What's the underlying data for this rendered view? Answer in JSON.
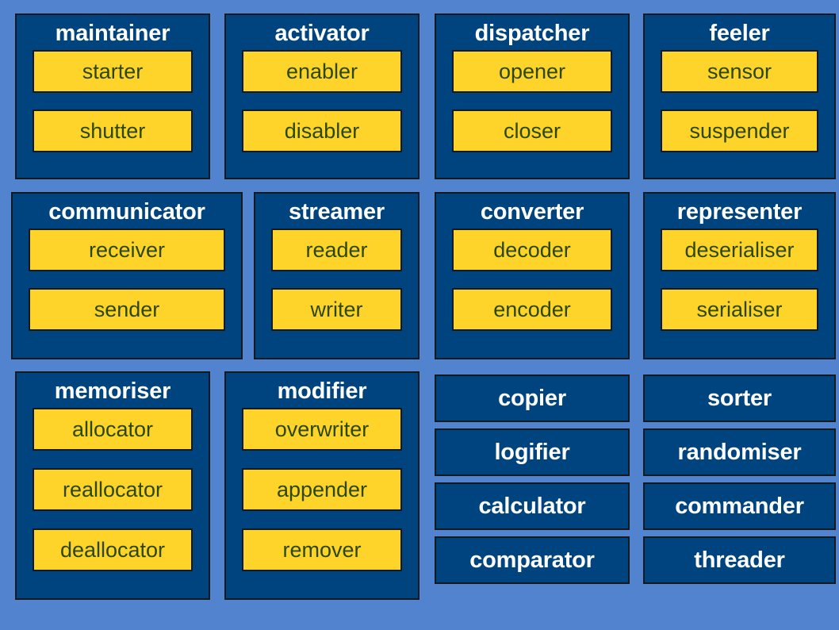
{
  "palette": {
    "background": "#5183ce",
    "card_blue": "#00447f",
    "chip_yellow": "#ffd42a",
    "outline": "#141a20",
    "title_text": "#ffffff",
    "chip_text": "#2c4800"
  },
  "groups": [
    {
      "title": "maintainer",
      "children": [
        "starter",
        "shutter"
      ]
    },
    {
      "title": "activator",
      "children": [
        "enabler",
        "disabler"
      ]
    },
    {
      "title": "dispatcher",
      "children": [
        "opener",
        "closer"
      ]
    },
    {
      "title": "feeler",
      "children": [
        "sensor",
        "suspender"
      ]
    },
    {
      "title": "communicator",
      "children": [
        "receiver",
        "sender"
      ]
    },
    {
      "title": "streamer",
      "children": [
        "reader",
        "writer"
      ]
    },
    {
      "title": "converter",
      "children": [
        "decoder",
        "encoder"
      ]
    },
    {
      "title": "representer",
      "children": [
        "deserialiser",
        "serialiser"
      ]
    },
    {
      "title": "memoriser",
      "children": [
        "allocator",
        "reallocator",
        "deallocator"
      ]
    },
    {
      "title": "modifier",
      "children": [
        "overwriter",
        "appender",
        "remover"
      ]
    }
  ],
  "standalone": [
    "copier",
    "logifier",
    "calculator",
    "comparator",
    "sorter",
    "randomiser",
    "commander",
    "threader"
  ]
}
